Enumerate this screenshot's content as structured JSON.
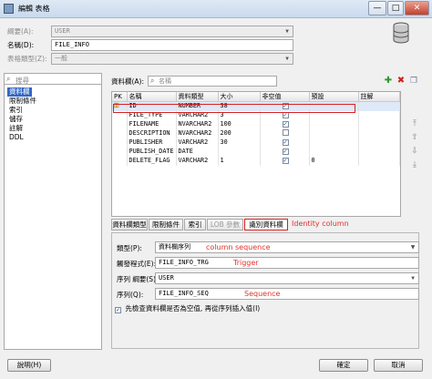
{
  "window": {
    "title": "編輯 表格",
    "controls": [
      "—",
      "□",
      "✕"
    ]
  },
  "form": {
    "schema_label": "綱要(A):",
    "schema_value": "USER",
    "name_label": "名稱(D):",
    "name_value": "FILE_INFO",
    "table_type_label": "表格類型(Z):",
    "table_type_value": "一般"
  },
  "nav": {
    "search_placeholder": "搜尋",
    "items": [
      "資料欄",
      "限制條件",
      "索引",
      "儲存",
      "註解",
      "DDL"
    ]
  },
  "columns_panel": {
    "label": "資料欄(A):",
    "search_placeholder": "名稱",
    "headers": [
      "PK",
      "名稱",
      "資料類型",
      "大小",
      "非空值",
      "預設",
      "註解"
    ],
    "rows": [
      {
        "pk": "key",
        "name": "ID",
        "type": "NUMBER",
        "size": "38",
        "notnull": true,
        "default": ""
      },
      {
        "pk": "",
        "name": "FILE_TYPE",
        "type": "VARCHAR2",
        "size": "3",
        "notnull": true,
        "default": ""
      },
      {
        "pk": "",
        "name": "FILENAME",
        "type": "NVARCHAR2",
        "size": "100",
        "notnull": true,
        "default": ""
      },
      {
        "pk": "",
        "name": "DESCRIPTION",
        "type": "NVARCHAR2",
        "size": "200",
        "notnull": false,
        "default": ""
      },
      {
        "pk": "",
        "name": "PUBLISHER",
        "type": "VARCHAR2",
        "size": "30",
        "notnull": true,
        "default": ""
      },
      {
        "pk": "",
        "name": "PUBLISH_DATE",
        "type": "DATE",
        "size": "",
        "notnull": true,
        "default": ""
      },
      {
        "pk": "",
        "name": "DELETE_FLAG",
        "type": "VARCHAR2",
        "size": "1",
        "notnull": true,
        "default": "0"
      }
    ]
  },
  "tabs": [
    "資料欄類型",
    "限制條件",
    "索引",
    "LOB 參數",
    "識別資料欄"
  ],
  "annotations": {
    "identity_column": "Identity column",
    "column_sequence": "column sequence",
    "trigger": "Trigger",
    "sequence": "Sequence"
  },
  "identity": {
    "type_label": "類型(P):",
    "type_value": "資料欄序列",
    "trigger_label": "觸發程式(E):",
    "trigger_value": "FILE_INFO_TRG",
    "seq_schema_label": "序列 綱要(S):",
    "seq_schema_value": "USER",
    "sequence_label": "序列(Q):",
    "sequence_value": "FILE_INFO_SEQ",
    "null_check_label": "先檢查資料欄是否為空值, 再從序列插入值(I)",
    "null_check": true
  },
  "footer": {
    "help": "說明(H)",
    "ok": "確定",
    "cancel": "取消"
  },
  "colors": {
    "selection": "#3168c6",
    "highlight": "#d62020"
  }
}
